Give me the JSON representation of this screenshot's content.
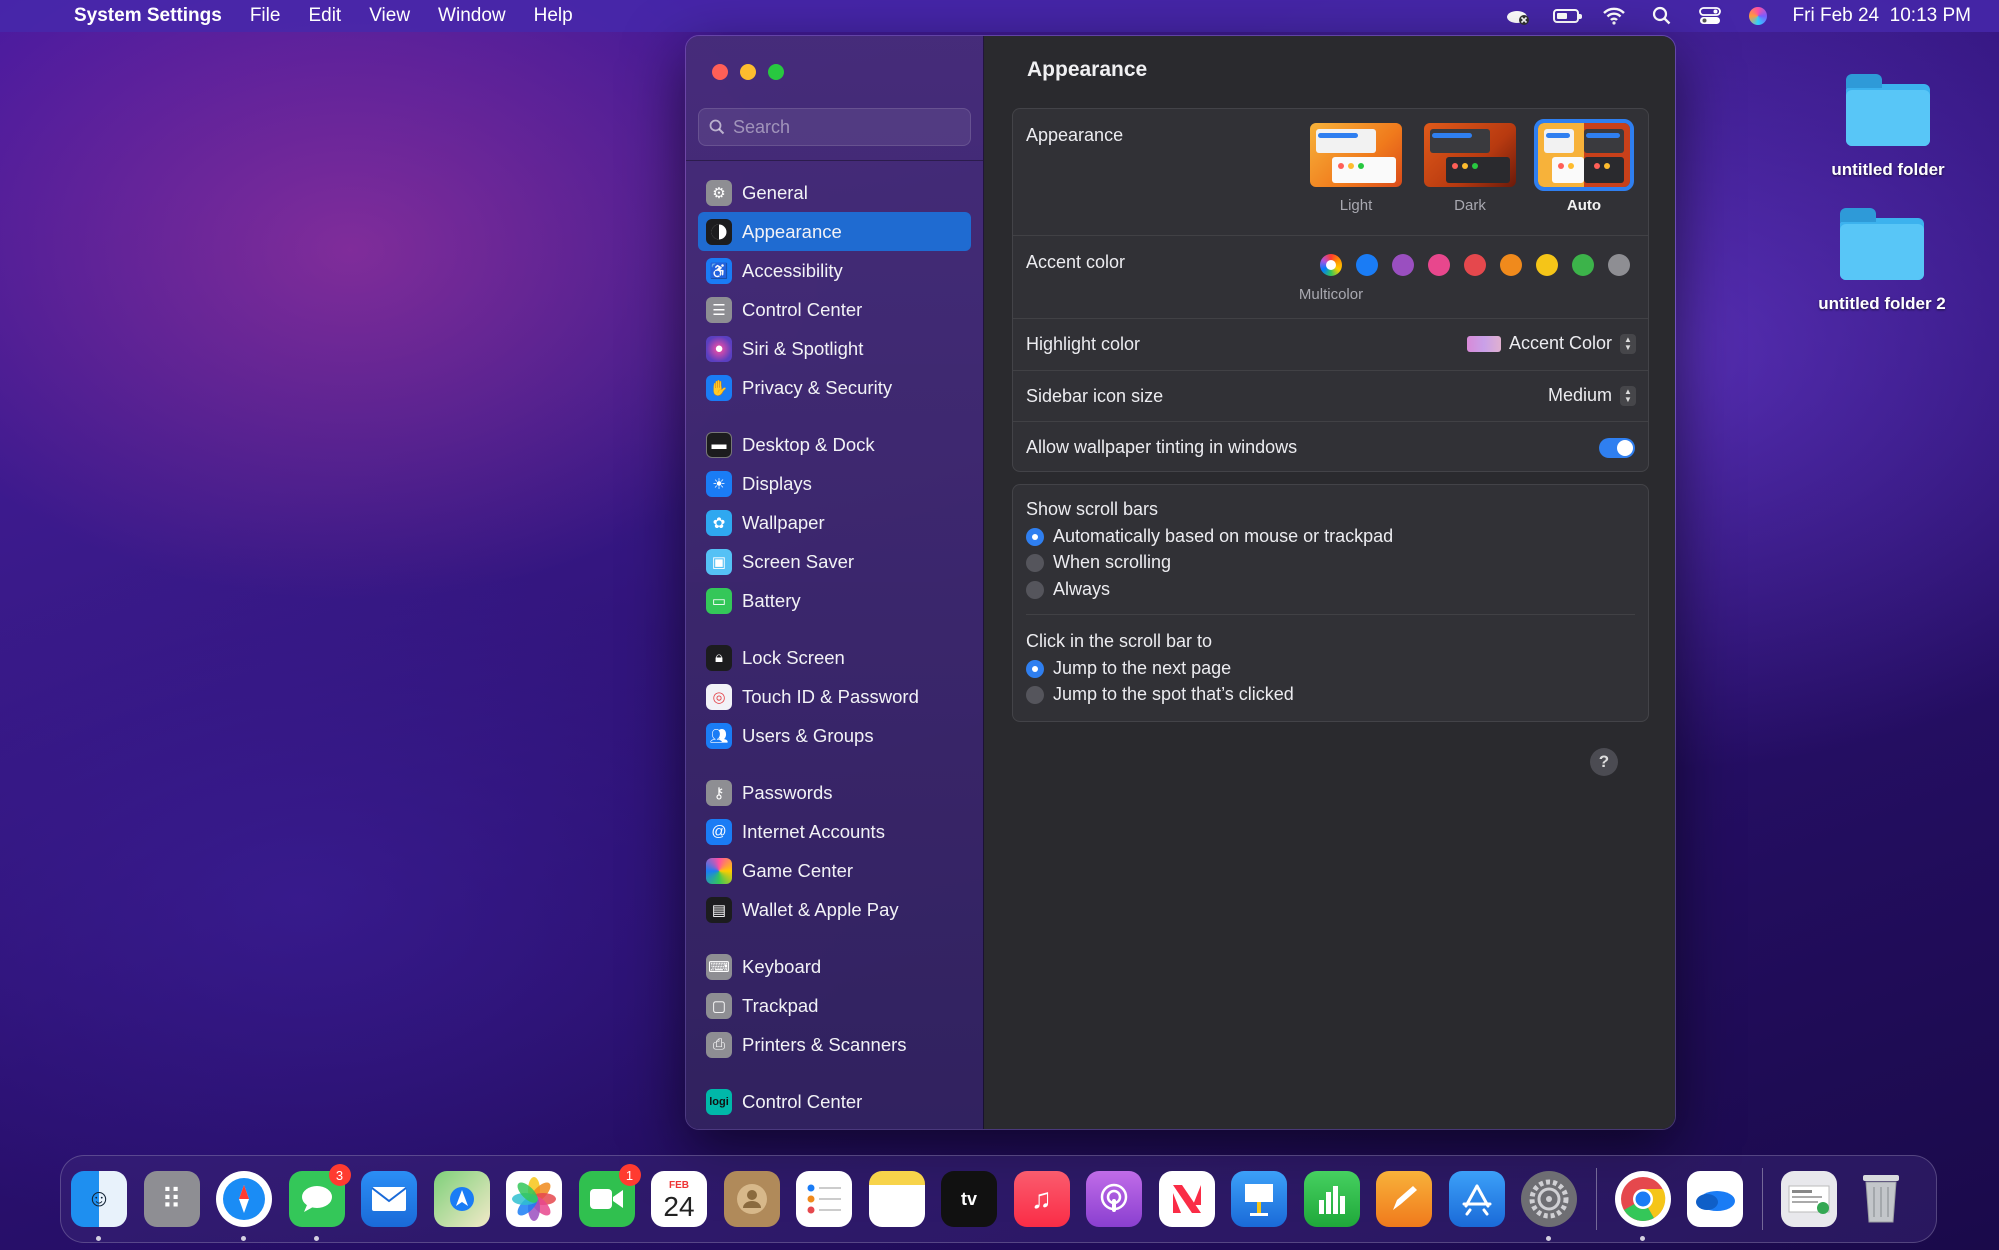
{
  "menubar": {
    "apple_icon": "apple-logo-icon",
    "app_name": "System Settings",
    "menus": [
      "File",
      "Edit",
      "View",
      "Window",
      "Help"
    ],
    "status_icons": [
      "creative-cloud-icon",
      "battery-icon",
      "wifi-icon",
      "spotlight-search-icon",
      "control-center-icon",
      "siri-icon"
    ],
    "clock": "Fri Feb 24  10:13 PM"
  },
  "desktop": {
    "folders": [
      "untitled folder",
      "untitled folder 2"
    ]
  },
  "window": {
    "search_placeholder": "Search",
    "sidebar": [
      {
        "label": "General",
        "icon": "gear-icon",
        "color": "#8e8e93"
      },
      {
        "label": "Appearance",
        "icon": "appearance-icon",
        "color": "#1c1c1e",
        "active": true
      },
      {
        "label": "Accessibility",
        "icon": "accessibility-icon",
        "color": "#1a7cf5"
      },
      {
        "label": "Control Center",
        "icon": "control-center-icon",
        "color": "#8e8e93"
      },
      {
        "label": "Siri & Spotlight",
        "icon": "siri-icon",
        "color": "#5a3fc0"
      },
      {
        "label": "Privacy & Security",
        "icon": "hand-icon",
        "color": "#1a7cf5"
      },
      {
        "label": "Desktop & Dock",
        "icon": "dock-icon",
        "color": "#1c1c1e"
      },
      {
        "label": "Displays",
        "icon": "sun-icon",
        "color": "#1a7cf5"
      },
      {
        "label": "Wallpaper",
        "icon": "flower-icon",
        "color": "#2fa8f0"
      },
      {
        "label": "Screen Saver",
        "icon": "screensaver-icon",
        "color": "#55c1f5"
      },
      {
        "label": "Battery",
        "icon": "battery-icon",
        "color": "#34c759"
      },
      {
        "label": "Lock Screen",
        "icon": "lock-icon",
        "color": "#1c1c1e"
      },
      {
        "label": "Touch ID & Password",
        "icon": "fingerprint-icon",
        "color": "#f2f2f7"
      },
      {
        "label": "Users & Groups",
        "icon": "users-icon",
        "color": "#1a7cf5"
      },
      {
        "label": "Passwords",
        "icon": "key-icon",
        "color": "#8e8e93"
      },
      {
        "label": "Internet Accounts",
        "icon": "at-icon",
        "color": "#1a7cf5"
      },
      {
        "label": "Game Center",
        "icon": "game-center-icon",
        "color": "#f2f2f7"
      },
      {
        "label": "Wallet & Apple Pay",
        "icon": "wallet-icon",
        "color": "#1c1c1e"
      },
      {
        "label": "Keyboard",
        "icon": "keyboard-icon",
        "color": "#8e8e93"
      },
      {
        "label": "Trackpad",
        "icon": "trackpad-icon",
        "color": "#8e8e93"
      },
      {
        "label": "Printers & Scanners",
        "icon": "printer-icon",
        "color": "#8e8e93"
      },
      {
        "label": "Control Center",
        "icon": "logi-icon",
        "color": "#00b8a9"
      }
    ],
    "content": {
      "title": "Appearance",
      "appearance": {
        "label": "Appearance",
        "options": [
          "Light",
          "Dark",
          "Auto"
        ],
        "selected": "Auto"
      },
      "accent": {
        "label": "Accent color",
        "colors": [
          "multicolor",
          "#1a7cf5",
          "#9a4fc0",
          "#e8478d",
          "#e5484d",
          "#f08a1c",
          "#f5c518",
          "#3cb34a",
          "#8e8e93"
        ],
        "selected_caption": "Multicolor"
      },
      "highlight": {
        "label": "Highlight color",
        "value": "Accent Color"
      },
      "sidebar_icon_size": {
        "label": "Sidebar icon size",
        "value": "Medium"
      },
      "wallpaper_tinting": {
        "label": "Allow wallpaper tinting in windows",
        "on": true
      },
      "scroll_bars": {
        "heading": "Show scroll bars",
        "options": [
          "Automatically based on mouse or trackpad",
          "When scrolling",
          "Always"
        ],
        "selected": 0
      },
      "click_scroll": {
        "heading": "Click in the scroll bar to",
        "options": [
          "Jump to the next page",
          "Jump to the spot that’s clicked"
        ],
        "selected": 0
      },
      "help": "?"
    }
  },
  "dock": {
    "apps": [
      {
        "name": "finder-icon",
        "color": "#1e8ff0",
        "running": true
      },
      {
        "name": "launchpad-icon",
        "color": "#8e8e93"
      },
      {
        "name": "safari-icon",
        "color": "#1a8cf5",
        "running": true
      },
      {
        "name": "messages-icon",
        "color": "#34c759",
        "badge": "3",
        "running": true
      },
      {
        "name": "mail-icon",
        "color": "#2b8ef5"
      },
      {
        "name": "maps-icon",
        "color": "#4cbf6a"
      },
      {
        "name": "photos-icon",
        "color": "#f5f5f5"
      },
      {
        "name": "facetime-icon",
        "color": "#30c04f",
        "badge": "1"
      },
      {
        "name": "calendar-icon",
        "month": "FEB",
        "day": "24"
      },
      {
        "name": "contacts-icon",
        "color": "#b08a5a"
      },
      {
        "name": "reminders-icon",
        "color": "#f5f5f5"
      },
      {
        "name": "notes-icon",
        "color": "#f7d34a"
      },
      {
        "name": "apple-tv-icon",
        "color": "#111111"
      },
      {
        "name": "music-icon",
        "color": "#fa3c56"
      },
      {
        "name": "podcasts-icon",
        "color": "#9b4fd8"
      },
      {
        "name": "news-icon",
        "color": "#f5f5f5"
      },
      {
        "name": "keynote-icon",
        "color": "#1d8cf0"
      },
      {
        "name": "numbers-icon",
        "color": "#2fbf4a"
      },
      {
        "name": "pages-icon",
        "color": "#f59b1a"
      },
      {
        "name": "app-store-icon",
        "color": "#1d8cf0"
      },
      {
        "name": "system-settings-icon",
        "color": "#6e6e73",
        "running": true
      }
    ],
    "recent_apps": [
      {
        "name": "chrome-icon",
        "color": "#f5f5f5",
        "running": true
      },
      {
        "name": "onedrive-icon",
        "color": "#f5f5f5"
      }
    ],
    "stacks": [
      {
        "name": "downloads-stack-icon",
        "color": "#e8e8ec"
      },
      {
        "name": "trash-icon",
        "color": "#bfc3c8"
      }
    ]
  }
}
